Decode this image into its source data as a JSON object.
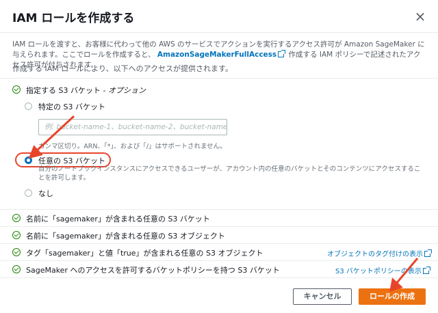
{
  "dialog": {
    "title": "IAM ロールを作成する",
    "close_symbol": "×",
    "intro_part1": "IAM ロールを渡すと、お客様に代わって他の AWS のサービスでアクションを実行するアクセス許可が Amazon SageMaker に与えられます。ここでロールを作成すると、",
    "intro_link": "AmazonSageMakerFullAccess",
    "intro_part2": "作成する IAM ポリシーで記述されたアクセス許可が付与されます。",
    "subtitle": "作成する IAM ロールにより、以下へのアクセスが提供されます。"
  },
  "s3_section": {
    "label": "指定する S3 バケット - ",
    "label_optional": "オプション",
    "options": [
      {
        "label": "特定の S3 バケット",
        "selected": false
      },
      {
        "label": "任意の S3 バケット",
        "selected": true
      },
      {
        "label": "なし",
        "selected": false
      }
    ],
    "input_placeholder": "例: bucket-name-1、bucket-name-2、bucket-name-3",
    "input_hint": "カンマ区切り。ARN、「*」、および「/」はサポートされません。",
    "any_bucket_description": "自分のノートブックインスタンスにアクセスできるユーザーが、アカウント内の任意のバケットとそのコンテンツにアクセスすることを許可します。"
  },
  "permissions": [
    {
      "label": "名前に「sagemaker」が含まれる任意の S3 バケット",
      "link": ""
    },
    {
      "label": "名前に「sagemaker」が含まれる任意の S3 オブジェクト",
      "link": ""
    },
    {
      "label": "タグ「sagemaker」と値「true」が含まれる任意の S3 オブジェクト",
      "link": "オブジェクトのタグ付けの表示"
    },
    {
      "label": "SageMaker へのアクセスを許可するバケットポリシーを持つ S3 バケット",
      "link": "S3 バケットポリシーの表示"
    }
  ],
  "footer": {
    "cancel_label": "キャンセル",
    "create_label": "ロールの作成"
  },
  "colors": {
    "primary": "#ec7211",
    "link": "#0073bb",
    "success": "#1d8102",
    "annotation": "#e8442a"
  },
  "icons": [
    "close-icon",
    "external-link-icon",
    "check-circle-icon"
  ]
}
